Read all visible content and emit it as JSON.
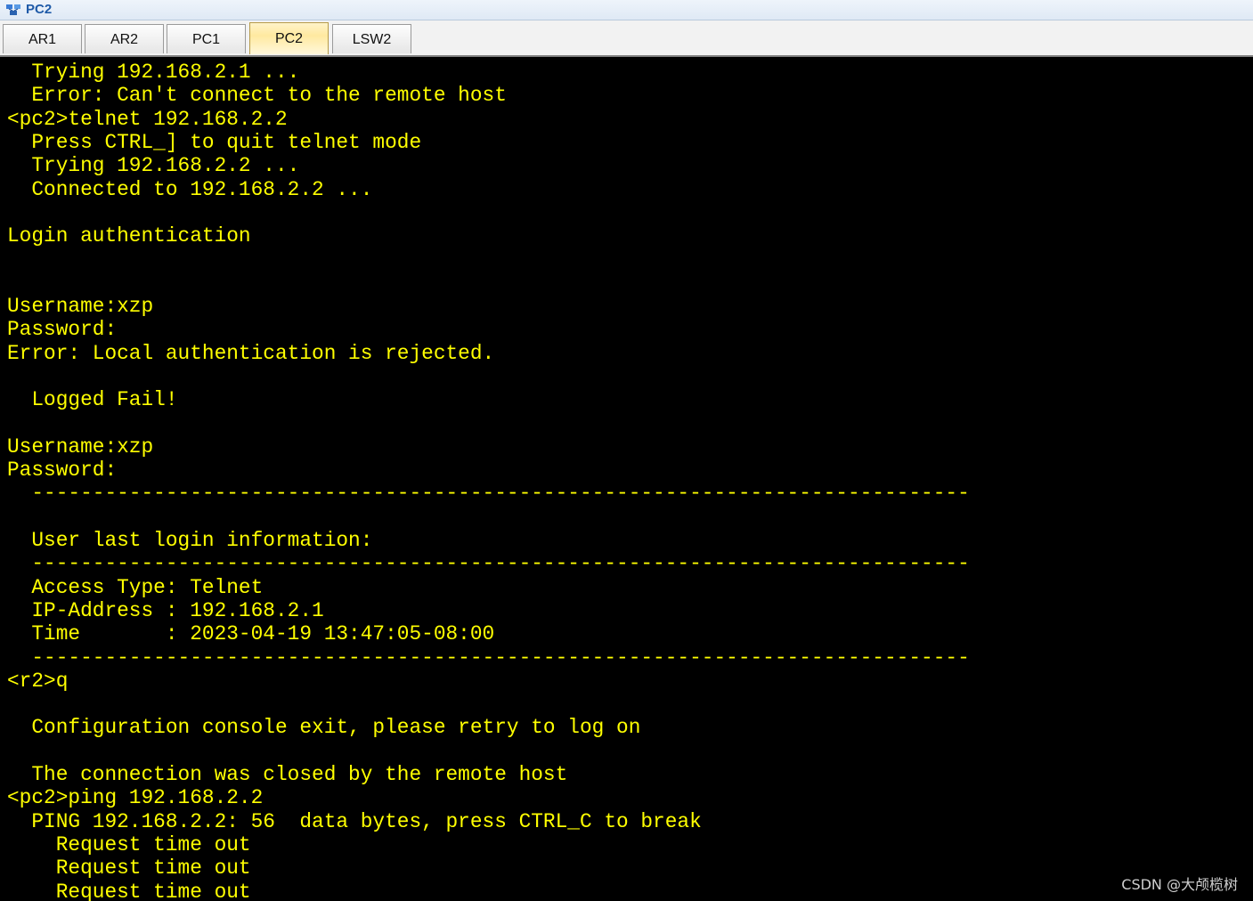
{
  "window": {
    "title": "PC2",
    "icon": "ensp-device-icon"
  },
  "tabs": [
    {
      "label": "AR1",
      "active": false
    },
    {
      "label": "AR2",
      "active": false
    },
    {
      "label": "PC1",
      "active": false
    },
    {
      "label": "PC2",
      "active": true
    },
    {
      "label": "LSW2",
      "active": false
    }
  ],
  "terminal": {
    "text_color": "#ffff00",
    "background": "#000000",
    "lines": [
      "  Trying 192.168.2.1 ...",
      "  Error: Can't connect to the remote host",
      "<pc2>telnet 192.168.2.2",
      "  Press CTRL_] to quit telnet mode",
      "  Trying 192.168.2.2 ...",
      "  Connected to 192.168.2.2 ...",
      "",
      "Login authentication",
      "",
      "",
      "Username:xzp",
      "Password:",
      "Error: Local authentication is rejected.",
      "",
      "  Logged Fail!",
      "",
      "Username:xzp",
      "Password:",
      "  -----------------------------------------------------------------------------",
      "",
      "  User last login information:",
      "  -----------------------------------------------------------------------------",
      "  Access Type: Telnet",
      "  IP-Address : 192.168.2.1",
      "  Time       : 2023-04-19 13:47:05-08:00",
      "  -----------------------------------------------------------------------------",
      "<r2>q",
      "",
      "  Configuration console exit, please retry to log on",
      "",
      "  The connection was closed by the remote host",
      "<pc2>ping 192.168.2.2",
      "  PING 192.168.2.2: 56  data bytes, press CTRL_C to break",
      "    Request time out",
      "    Request time out",
      "    Request time out"
    ]
  },
  "watermark": "CSDN @大颅榄树"
}
